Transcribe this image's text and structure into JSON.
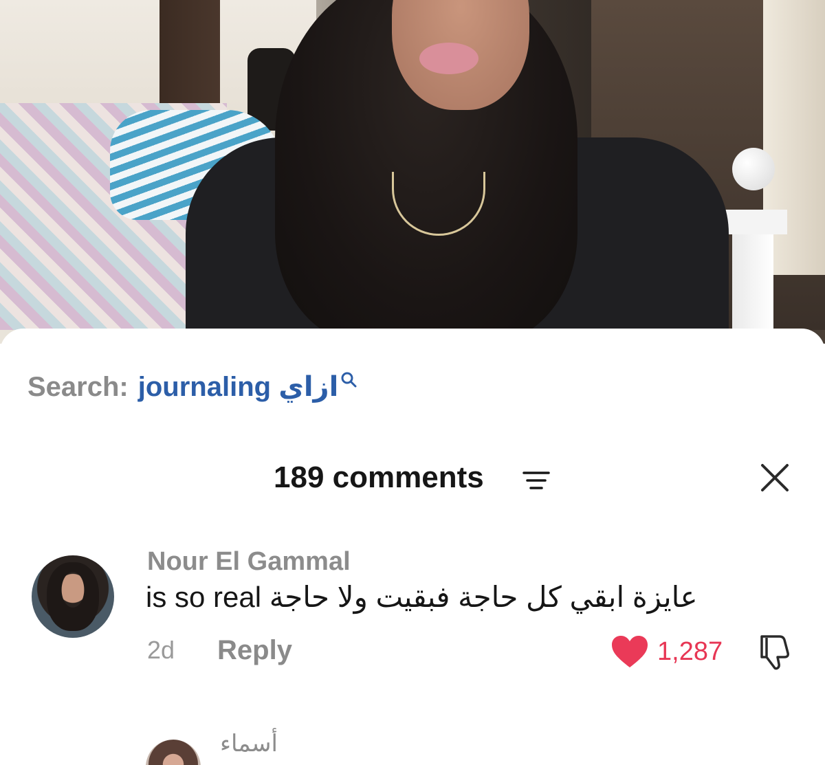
{
  "search": {
    "label": "Search:",
    "query": "journaling ازاي"
  },
  "comments": {
    "title": "189 comments",
    "items": [
      {
        "username": "Nour El Gammal",
        "text": "عايزة ابقي كل حاجة فبقيت ولا حاجة is so real",
        "time": "2d",
        "reply_label": "Reply",
        "likes": "1,287"
      },
      {
        "username": "أسماء"
      }
    ]
  },
  "colors": {
    "accent_link": "#2c5ea8",
    "like_red": "#e73654",
    "muted_text": "#8c8c8c"
  },
  "icons": {
    "search": "search-icon",
    "sort": "sort-icon",
    "close": "close-icon",
    "like": "heart-icon",
    "dislike": "dislike-icon"
  }
}
